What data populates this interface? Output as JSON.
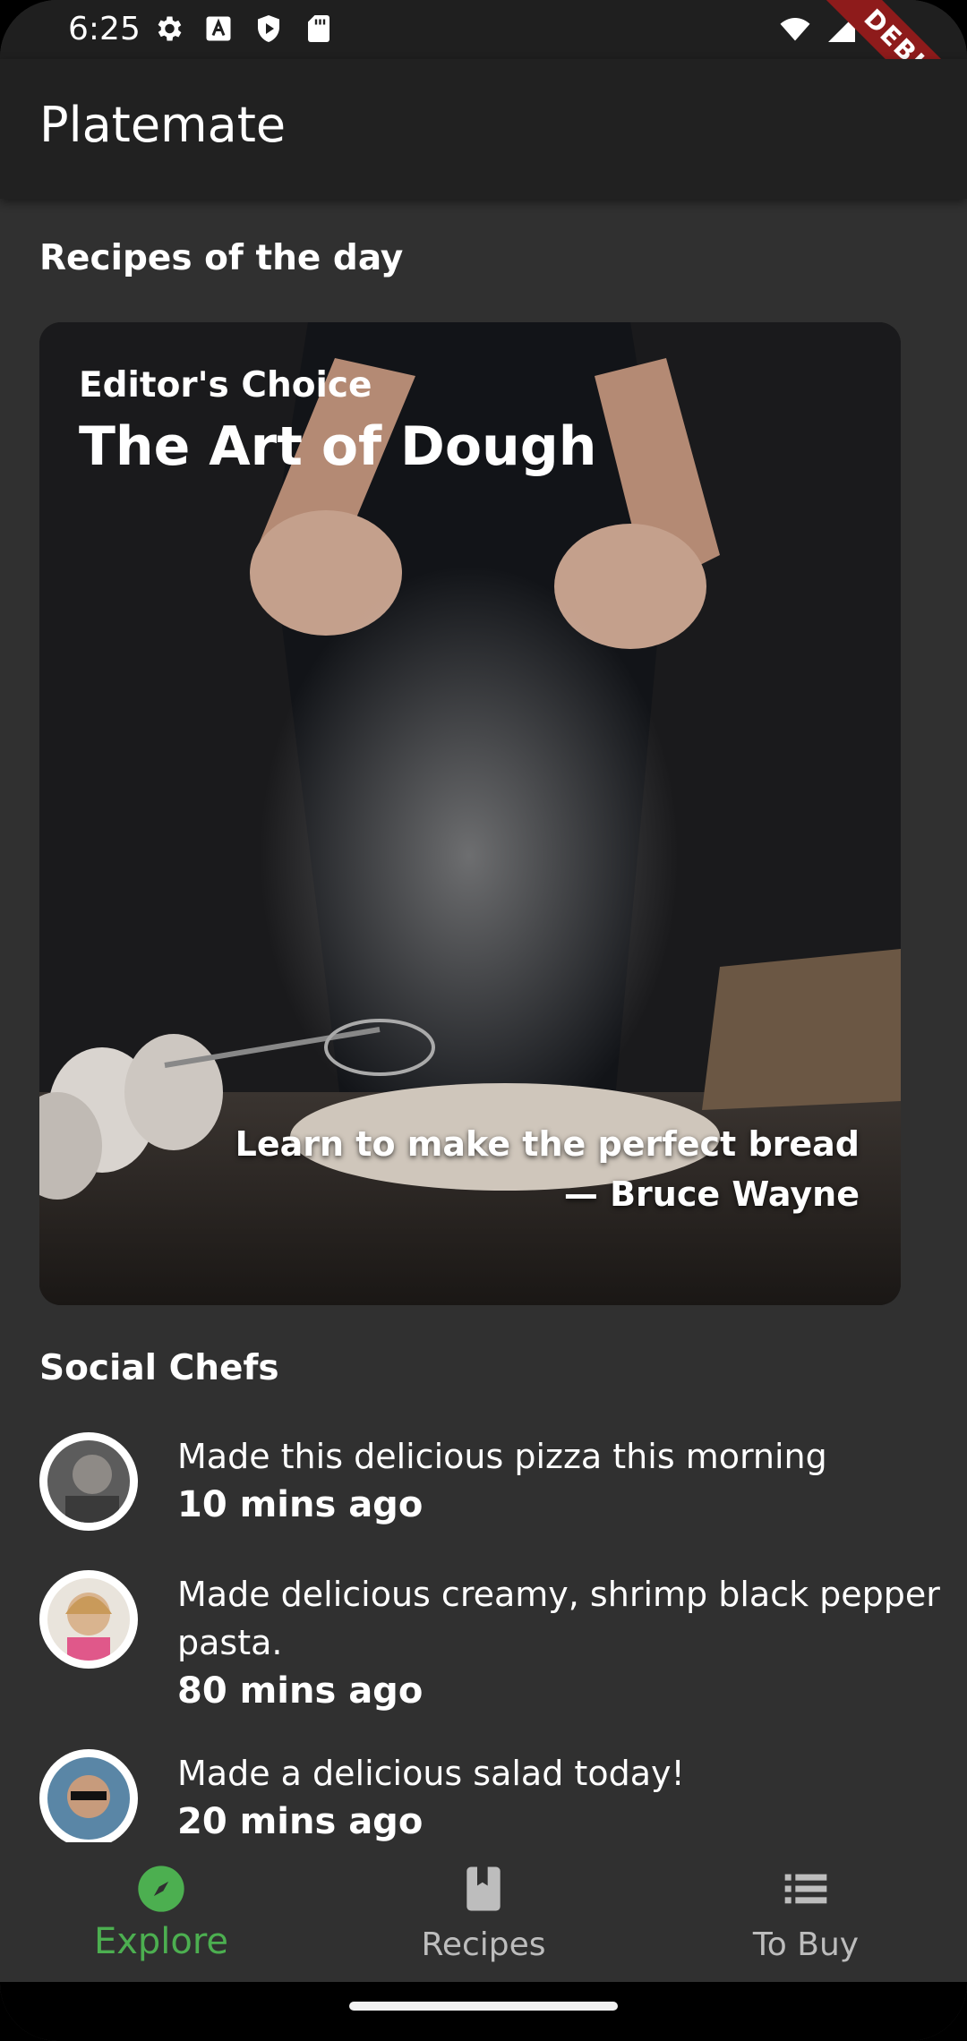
{
  "status_bar": {
    "time": "6:25",
    "debug_label": "DEBUG"
  },
  "app_bar": {
    "title": "Platemate"
  },
  "recipes_section": {
    "title": "Recipes of the day",
    "card": {
      "subtitle": "Editor's Choice",
      "title": "The Art of Dough",
      "description": "Learn to make the perfect bread",
      "author": "— Bruce Wayne"
    }
  },
  "social_section": {
    "title": "Social Chefs",
    "posts": [
      {
        "message": "Made this delicious pizza this morning",
        "time": "10 mins ago"
      },
      {
        "message": "Made delicious creamy, shrimp black pepper pasta.",
        "time": "80 mins ago"
      },
      {
        "message": "Made a delicious salad today!",
        "time": "20 mins ago"
      }
    ]
  },
  "bottom_nav": {
    "items": [
      {
        "label": "Explore",
        "icon": "compass-icon",
        "active": true
      },
      {
        "label": "Recipes",
        "icon": "book-icon",
        "active": false
      },
      {
        "label": "To Buy",
        "icon": "list-icon",
        "active": false
      }
    ],
    "active_color": "#4caf50"
  }
}
